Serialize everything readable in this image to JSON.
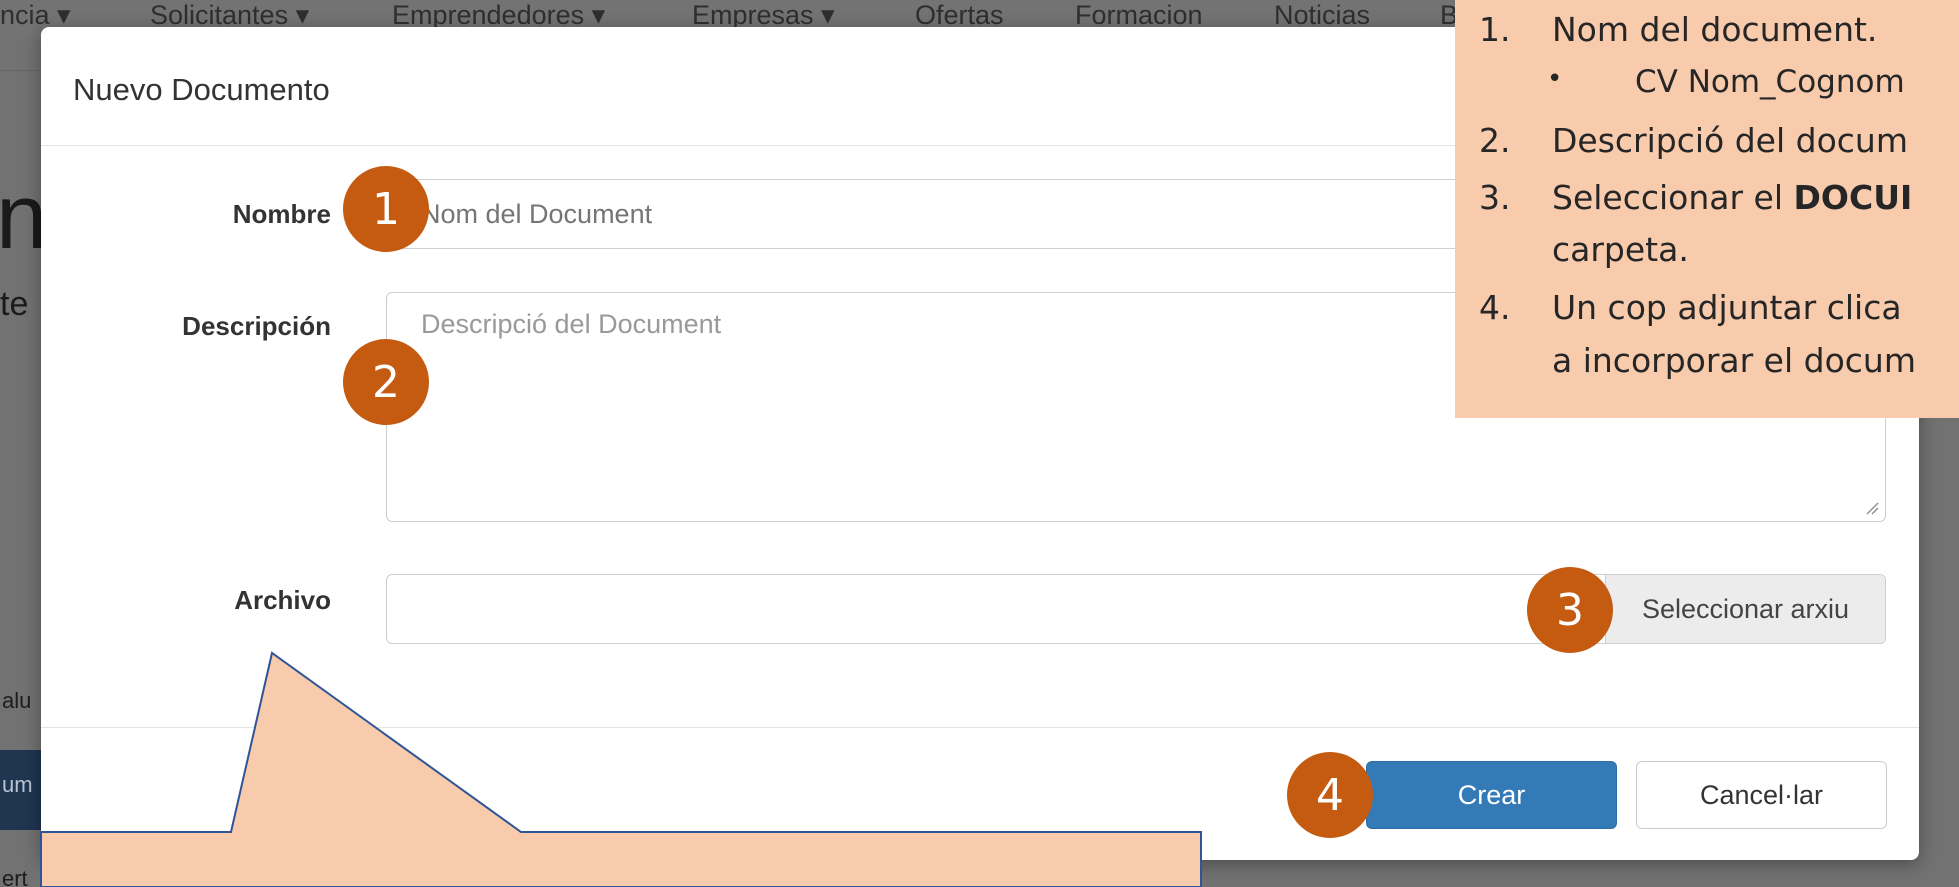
{
  "background": {
    "nav_items": [
      "ncia ▾",
      "Solicitantes ▾",
      "Emprendedores ▾",
      "Empresas ▾",
      "Ofertas",
      "Formacion",
      "Noticias",
      "B"
    ],
    "big_char": "n",
    "small_char": "te",
    "side_texts": [
      "alu",
      "um",
      "ert"
    ]
  },
  "modal": {
    "title": "Nuevo Documento",
    "fields": {
      "name": {
        "label": "Nombre",
        "placeholder": "Nom del Document"
      },
      "description": {
        "label": "Descripción",
        "placeholder": "Descripció del Document"
      },
      "file": {
        "label": "Archivo",
        "button": "Seleccionar arxiu"
      }
    },
    "buttons": {
      "create": "Crear",
      "cancel": "Cancel·lar"
    }
  },
  "badges": [
    "1",
    "2",
    "3",
    "4"
  ],
  "note": {
    "items": [
      {
        "num": "1.",
        "text": "Nom del document."
      },
      {
        "bullet": "•",
        "text": "CV Nom_Cognom"
      },
      {
        "num": "2.",
        "text": "Descripció del docum"
      },
      {
        "num": "3.",
        "text_before": "Seleccionar el ",
        "text_bold": "DOCUI",
        "text_cont": "carpeta."
      },
      {
        "num": "4.",
        "text": "Un cop adjuntar clica",
        "text_cont": "a incorporar el docum"
      }
    ]
  },
  "colors": {
    "accent_badge": "#c55a11",
    "note_bg": "#f8cbad",
    "primary_button": "#337ab7"
  }
}
